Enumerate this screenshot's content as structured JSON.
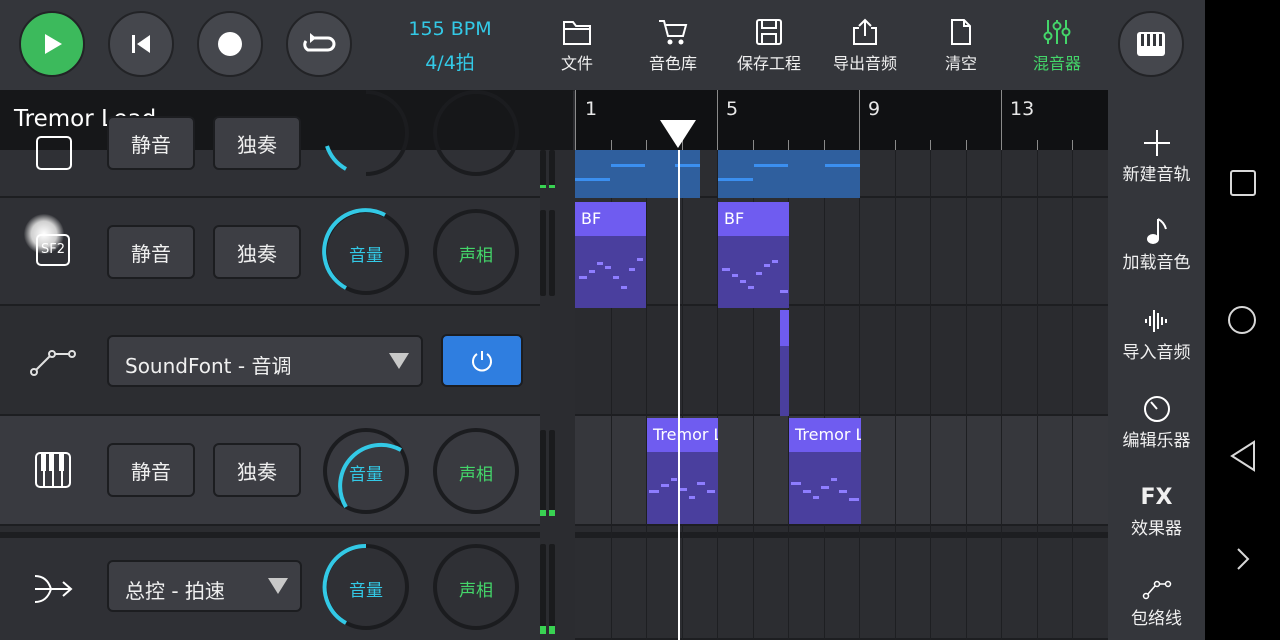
{
  "transport": {
    "bpm": "155 BPM",
    "time_signature": "4/4拍"
  },
  "toolbar": {
    "file": "文件",
    "sound_library": "音色库",
    "save_project": "保存工程",
    "export_audio": "导出音频",
    "clear": "清空",
    "mixer": "混音器"
  },
  "track_name": "Tremor Lead",
  "ruler": [
    "1",
    "5",
    "9",
    "13"
  ],
  "tracks": {
    "top_partial": {
      "mute": "静音",
      "solo": "独奏"
    },
    "sf2": {
      "icon": "SF2",
      "mute": "静音",
      "solo": "独奏",
      "volume": "音量",
      "pan": "声相"
    },
    "envelope": {
      "select": "SoundFont - 音调"
    },
    "tremor": {
      "mute": "静音",
      "solo": "独奏",
      "volume": "音量",
      "pan": "声相"
    },
    "master": {
      "select": "总控 - 拍速",
      "volume": "音量",
      "pan": "声相"
    }
  },
  "clips": {
    "bf_1": "BF",
    "bf_2": "BF",
    "tremor_1": "Tremor L",
    "tremor_2": "Tremor L"
  },
  "sidebar": {
    "new_track": "新建音轨",
    "load_sound": "加载音色",
    "import_audio": "导入音频",
    "edit_instrument": "编辑乐器",
    "fx_label": "FX",
    "effects": "效果器",
    "envelope": "包络线"
  },
  "colors": {
    "accent_cyan": "#33c9e6",
    "play_green": "#3cba5c",
    "pan_green": "#44d66a",
    "clip_purple": "#6f5cf0",
    "clip_blue": "#2f5f9e",
    "power_blue": "#2f7ee0"
  }
}
